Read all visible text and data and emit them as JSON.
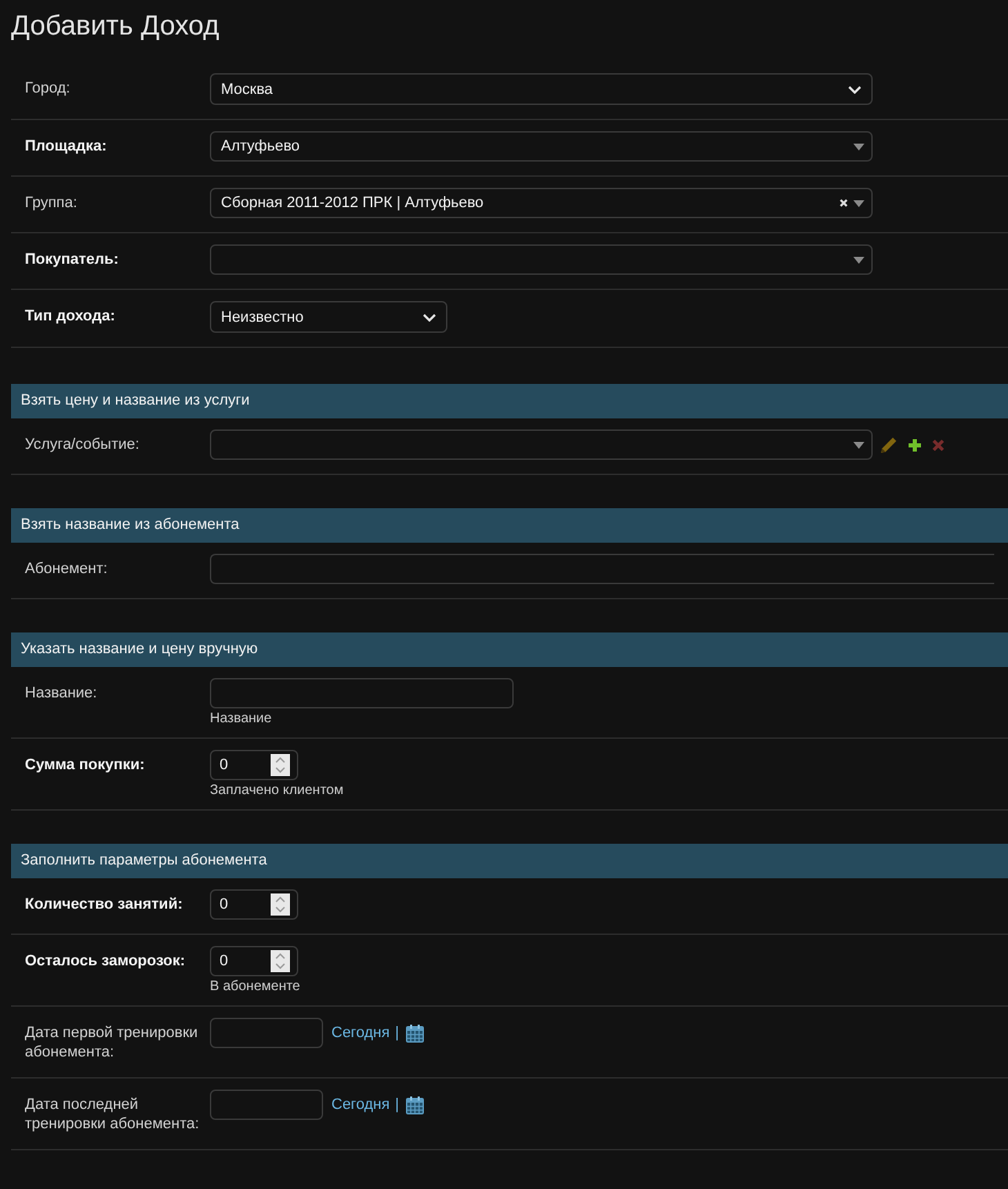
{
  "page_title": "Добавить Доход",
  "main_fields": [
    {
      "kind": "select",
      "label": "Город:",
      "required": false,
      "value": "Москва"
    },
    {
      "kind": "autocomplete",
      "label": "Площадка:",
      "required": true,
      "value": "Алтуфьево",
      "clearable": false
    },
    {
      "kind": "autocomplete",
      "label": "Группа:",
      "required": false,
      "value": "Сборная 2011-2012 ПРК | Алтуфьево",
      "clearable": true
    },
    {
      "kind": "autocomplete",
      "label": "Покупатель:",
      "required": true,
      "clearable": false
    },
    {
      "kind": "dropdown",
      "label": "Тип дохода:",
      "required": true,
      "value": "Неизвестно"
    }
  ],
  "fieldsets": [
    {
      "title": "Взять цену и название из услуги",
      "fields": [
        {
          "kind": "autocomplete",
          "label": "Услуга/событие:",
          "required": false,
          "clearable": false,
          "actions": [
            {
              "kind": "edit",
              "disabled": true
            },
            {
              "kind": "add",
              "disabled": false
            },
            {
              "kind": "delete",
              "disabled": true
            }
          ]
        }
      ]
    },
    {
      "title": "Взять название из абонемента",
      "fields": [
        {
          "kind": "longtext",
          "label": "Абонемент:",
          "required": false
        }
      ]
    },
    {
      "title": "Указать название и цену вручную",
      "fields": [
        {
          "kind": "text",
          "label": "Название:",
          "required": false,
          "help": "Название"
        },
        {
          "kind": "number",
          "label": "Сумма покупки:",
          "required": true,
          "value": "0",
          "help": "Заплачено клиентом"
        }
      ]
    },
    {
      "title": "Заполнить параметры абонемента",
      "fields": [
        {
          "kind": "number",
          "label": "Количество занятий:",
          "required": true,
          "value": "0"
        },
        {
          "kind": "number",
          "label": "Осталось заморозок:",
          "required": true,
          "value": "0",
          "help": "В абонементе"
        },
        {
          "kind": "date",
          "label": "Дата первой тренировки абонемента:",
          "required": false,
          "shortcut": "Сегодня",
          "separator": "|"
        },
        {
          "kind": "date",
          "label": "Дата последней тренировки абонемента:",
          "required": false,
          "shortcut": "Сегодня",
          "separator": "|"
        }
      ]
    }
  ]
}
